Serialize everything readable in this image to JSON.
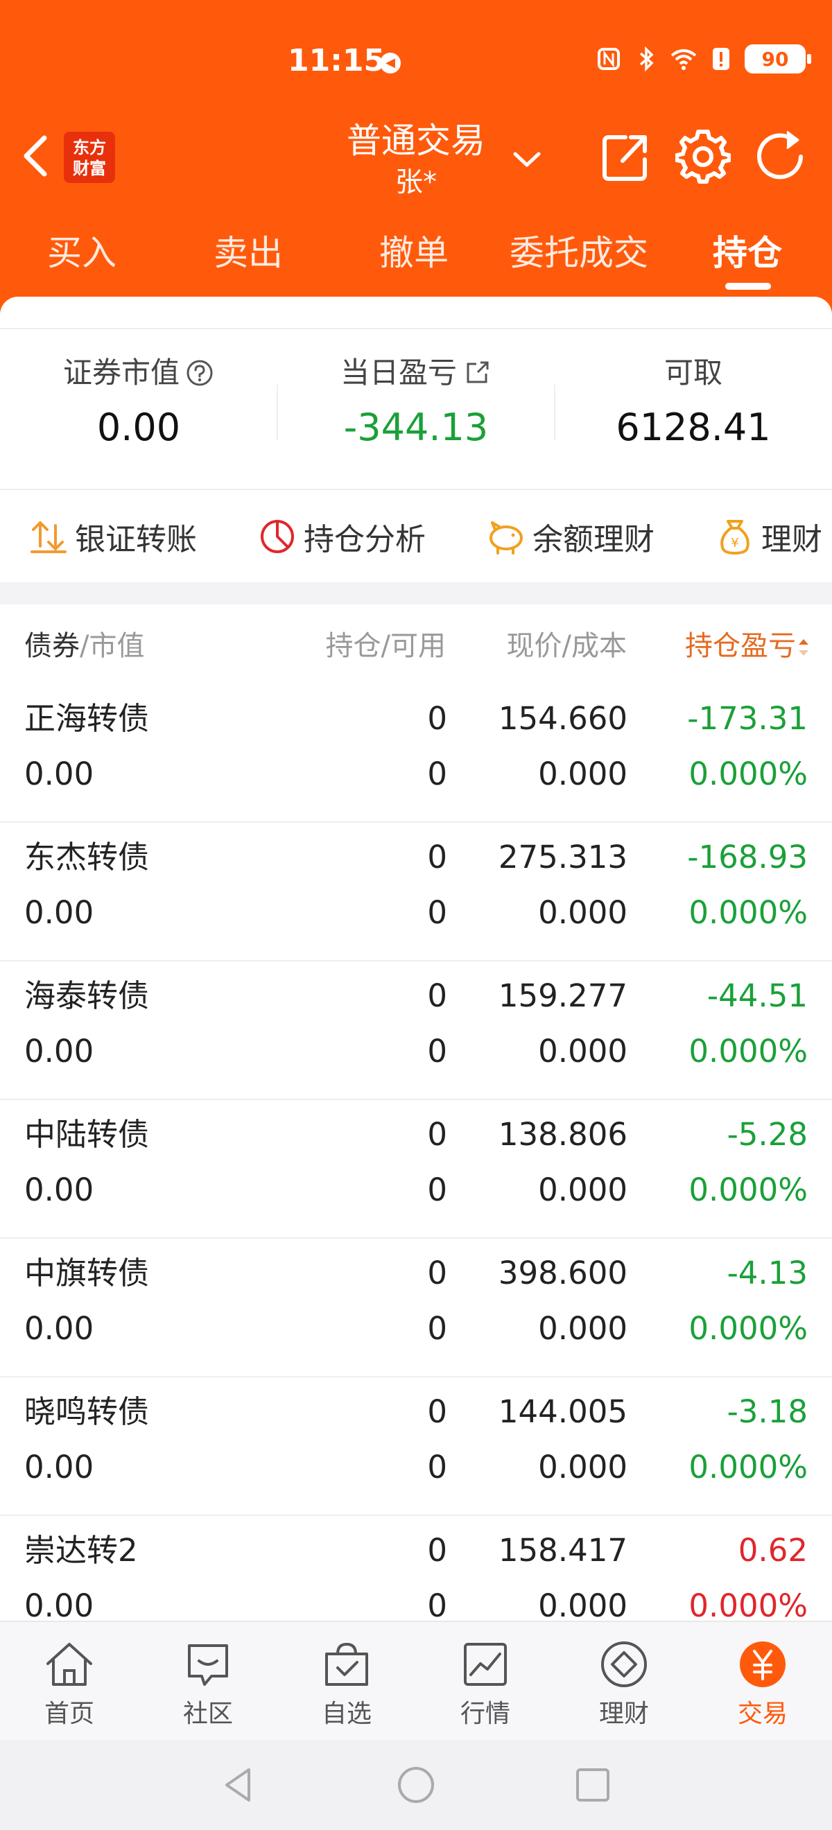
{
  "status_bar": {
    "time": "11:15",
    "battery": "90"
  },
  "header": {
    "logo_line1": "东方",
    "logo_line2": "财富",
    "title": "普通交易",
    "account": "张*"
  },
  "tabs": [
    {
      "label": "买入"
    },
    {
      "label": "卖出"
    },
    {
      "label": "撤单"
    },
    {
      "label": "委托成交"
    },
    {
      "label": "持仓"
    }
  ],
  "summary": {
    "market_value_label": "证券市值",
    "market_value": "0.00",
    "daily_pl_label": "当日盈亏",
    "daily_pl": "-344.13",
    "withdrawable_label": "可取",
    "withdrawable": "6128.41"
  },
  "quick_actions": [
    {
      "label": "银证转账"
    },
    {
      "label": "持仓分析"
    },
    {
      "label": "余额理财"
    },
    {
      "label": "理财"
    }
  ],
  "table": {
    "col1_a": "债券",
    "col1_b": "/市值",
    "col2": "持仓/可用",
    "col3": "现价/成本",
    "col4": "持仓盈亏",
    "rows": [
      {
        "name": "正海转债",
        "market_value": "0.00",
        "holding": "0",
        "available": "0",
        "price": "154.660",
        "cost": "0.000",
        "pl": "-173.31",
        "pl_pct": "0.000%",
        "trend": "down"
      },
      {
        "name": "东杰转债",
        "market_value": "0.00",
        "holding": "0",
        "available": "0",
        "price": "275.313",
        "cost": "0.000",
        "pl": "-168.93",
        "pl_pct": "0.000%",
        "trend": "down"
      },
      {
        "name": "海泰转债",
        "market_value": "0.00",
        "holding": "0",
        "available": "0",
        "price": "159.277",
        "cost": "0.000",
        "pl": "-44.51",
        "pl_pct": "0.000%",
        "trend": "down"
      },
      {
        "name": "中陆转债",
        "market_value": "0.00",
        "holding": "0",
        "available": "0",
        "price": "138.806",
        "cost": "0.000",
        "pl": "-5.28",
        "pl_pct": "0.000%",
        "trend": "down"
      },
      {
        "name": "中旗转债",
        "market_value": "0.00",
        "holding": "0",
        "available": "0",
        "price": "398.600",
        "cost": "0.000",
        "pl": "-4.13",
        "pl_pct": "0.000%",
        "trend": "down"
      },
      {
        "name": "晓鸣转债",
        "market_value": "0.00",
        "holding": "0",
        "available": "0",
        "price": "144.005",
        "cost": "0.000",
        "pl": "-3.18",
        "pl_pct": "0.000%",
        "trend": "down"
      },
      {
        "name": "崇达转2",
        "market_value": "0.00",
        "holding": "0",
        "available": "0",
        "price": "158.417",
        "cost": "0.000",
        "pl": "0.62",
        "pl_pct": "0.000%",
        "trend": "up"
      }
    ]
  },
  "bottom_nav": [
    {
      "label": "首页"
    },
    {
      "label": "社区"
    },
    {
      "label": "自选"
    },
    {
      "label": "行情"
    },
    {
      "label": "理财"
    },
    {
      "label": "交易"
    }
  ],
  "colors": {
    "brand": "#ff5a0c",
    "down": "#1aa038",
    "up": "#e0262c"
  }
}
